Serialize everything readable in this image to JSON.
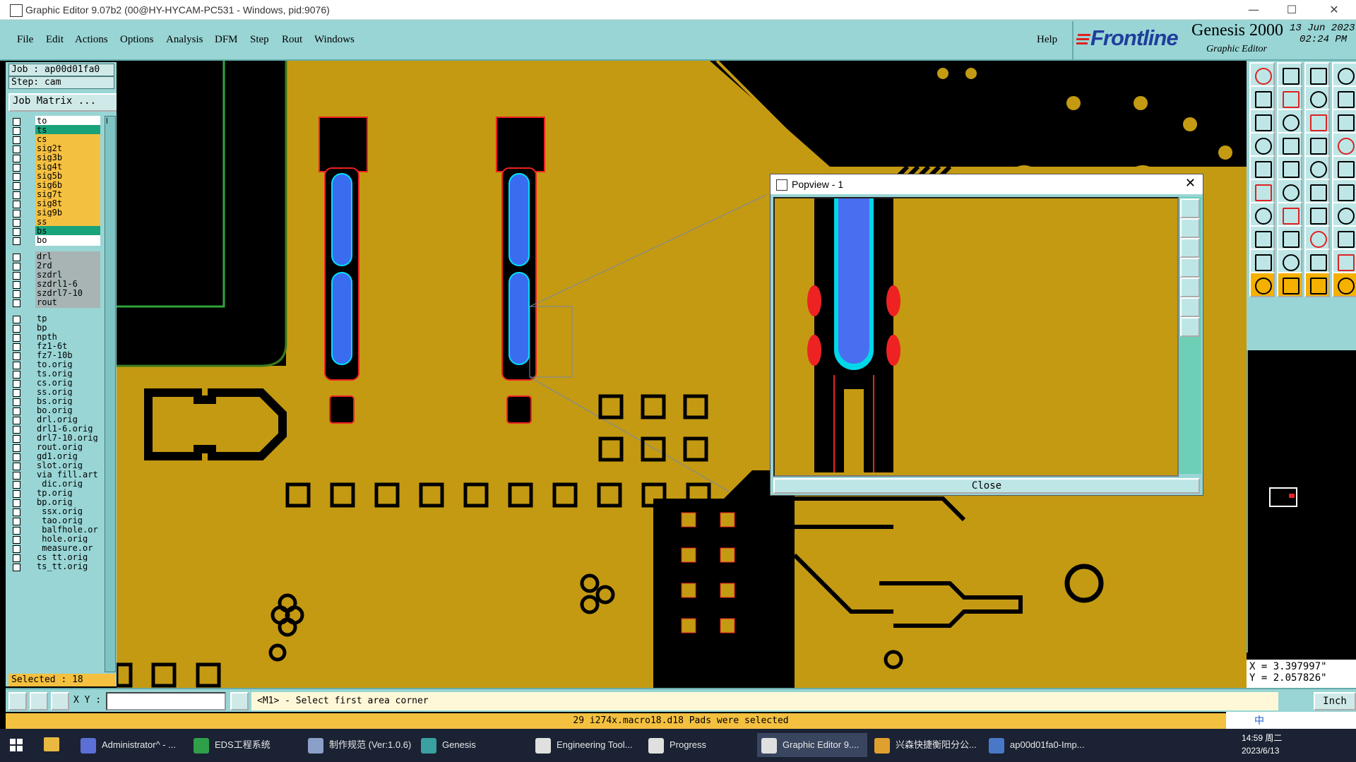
{
  "window": {
    "title": "Graphic Editor 9.07b2 (00@HY-HYCAM-PC531 - Windows, pid:9076)",
    "minimize": "—",
    "maximize": "☐",
    "close": "✕"
  },
  "menu": [
    "File",
    "Edit",
    "Actions",
    "Options",
    "Analysis",
    "DFM",
    "Step",
    "Rout",
    "Windows"
  ],
  "help": "Help",
  "brand": {
    "logo": "Frontline",
    "product": "Genesis 2000",
    "subtitle": "Graphic Editor",
    "date": "13 Jun 2023",
    "time": "02:24 PM"
  },
  "job": {
    "job_line": "Job : ap00d01fa0",
    "step_line": "Step: cam",
    "job_matrix": "Job Matrix ..."
  },
  "layers": [
    {
      "name": "to",
      "color": "#ffffff"
    },
    {
      "name": "ts",
      "color": "#1aa37a"
    },
    {
      "name": "cs",
      "color": "#f4c040"
    },
    {
      "name": "sig2t",
      "color": "#f4c040"
    },
    {
      "name": "sig3b",
      "color": "#f4c040"
    },
    {
      "name": "sig4t",
      "color": "#f4c040"
    },
    {
      "name": "sig5b",
      "color": "#f4c040"
    },
    {
      "name": "sig6b",
      "color": "#f4c040"
    },
    {
      "name": "sig7t",
      "color": "#f4c040"
    },
    {
      "name": "sig8t",
      "color": "#f4c040"
    },
    {
      "name": "sig9b",
      "color": "#f4c040"
    },
    {
      "name": "ss",
      "color": "#f4c040"
    },
    {
      "name": "bs",
      "color": "#1aa37a"
    },
    {
      "name": "bo",
      "color": "#ffffff"
    },
    {
      "name": "drl",
      "color": "#a8b4b4"
    },
    {
      "name": "2rd",
      "color": "#a8b4b4"
    },
    {
      "name": "szdrl",
      "color": "#a8b4b4"
    },
    {
      "name": "szdrl1-6",
      "color": "#a8b4b4"
    },
    {
      "name": "szdrl7-10",
      "color": "#a8b4b4"
    },
    {
      "name": "rout",
      "color": "#a8b4b4"
    },
    {
      "name": "tp",
      "color": "#99d5d5"
    },
    {
      "name": "bp",
      "color": "#99d5d5"
    },
    {
      "name": "npth",
      "color": "#99d5d5"
    },
    {
      "name": "fz1-6t",
      "color": "#99d5d5"
    },
    {
      "name": "fz7-10b",
      "color": "#99d5d5"
    },
    {
      "name": "to.orig",
      "color": "#99d5d5"
    },
    {
      "name": "ts.orig",
      "color": "#99d5d5"
    },
    {
      "name": "cs.orig",
      "color": "#99d5d5"
    },
    {
      "name": "ss.orig",
      "color": "#99d5d5"
    },
    {
      "name": "bs.orig",
      "color": "#99d5d5"
    },
    {
      "name": "bo.orig",
      "color": "#99d5d5"
    },
    {
      "name": "drl.orig",
      "color": "#99d5d5"
    },
    {
      "name": "drl1-6.orig",
      "color": "#99d5d5"
    },
    {
      "name": "drl7-10.orig",
      "color": "#99d5d5"
    },
    {
      "name": "rout.orig",
      "color": "#99d5d5"
    },
    {
      "name": "gd1.orig",
      "color": "#99d5d5"
    },
    {
      "name": "slot.orig",
      "color": "#99d5d5"
    },
    {
      "name": "via_fill.art",
      "color": "#99d5d5"
    },
    {
      "name": "_dic.orig",
      "color": "#99d5d5"
    },
    {
      "name": "tp.orig",
      "color": "#99d5d5"
    },
    {
      "name": "bp.orig",
      "color": "#99d5d5"
    },
    {
      "name": "_ssx.orig",
      "color": "#99d5d5"
    },
    {
      "name": "_tao.orig",
      "color": "#99d5d5"
    },
    {
      "name": "_balfhole.or",
      "color": "#99d5d5"
    },
    {
      "name": "_hole.orig",
      "color": "#99d5d5"
    },
    {
      "name": "_measure.or",
      "color": "#99d5d5"
    },
    {
      "name": "cs_tt.orig",
      "color": "#99d5d5"
    },
    {
      "name": "ts_tt.orig",
      "color": "#99d5d5"
    }
  ],
  "selected": "Selected : 18",
  "coords": {
    "x": "X = 3.397997\"",
    "y": "Y = 2.057826\""
  },
  "cmd": {
    "xy_label": "X Y :",
    "xy_value": "",
    "prompt": "<M1> - Select first area corner",
    "unit": "Inch"
  },
  "message": "29 i274x.macro18.d18 Pads were selected",
  "popview": {
    "title": "Popview - 1",
    "close": "Close"
  },
  "taskbar": [
    {
      "label": "Administrator^ - ...",
      "icon_color": "#5b6fd6",
      "active": false
    },
    {
      "label": "EDS工程系统",
      "icon_color": "#2fa04a",
      "active": false
    },
    {
      "label": "制作规范 (Ver:1.0.6)",
      "icon_color": "#8aa0c8",
      "active": false
    },
    {
      "label": "Genesis",
      "icon_color": "#3aa0a0",
      "active": false
    },
    {
      "label": "Engineering Tool...",
      "icon_color": "#e0e0e0",
      "active": false
    },
    {
      "label": "Progress",
      "icon_color": "#e0e0e0",
      "active": false
    },
    {
      "label": "Graphic Editor 9....",
      "icon_color": "#e0e0e0",
      "active": true
    },
    {
      "label": "兴森快捷衡阳分公...",
      "icon_color": "#e0a030",
      "active": false
    },
    {
      "label": "ap00d01fa0-Imp...",
      "icon_color": "#4a78c8",
      "active": false
    }
  ],
  "clock": {
    "time": "14:59 周二",
    "date": "2023/6/13"
  },
  "ime": "中"
}
